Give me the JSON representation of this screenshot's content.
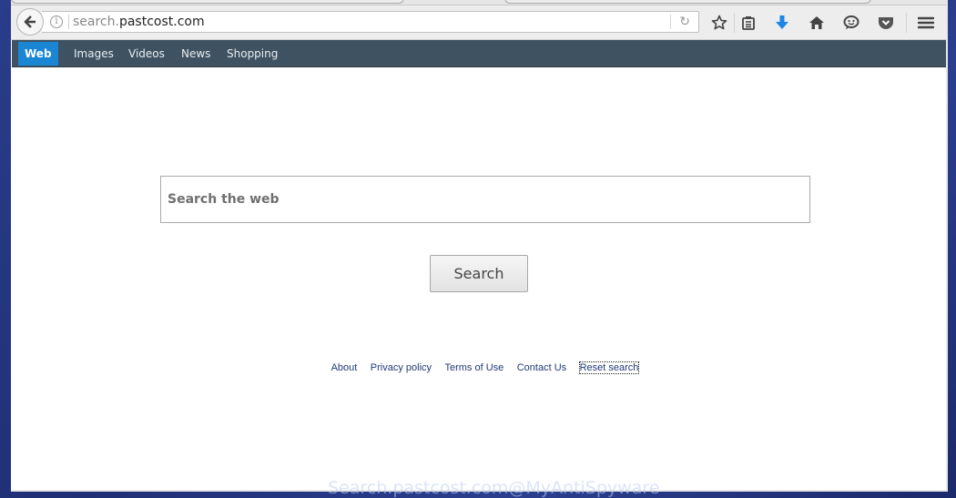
{
  "browser": {
    "url_prefix": "search.",
    "url_domain": "pastcost.com",
    "icons": {
      "back": "back-arrow-icon",
      "info": "info-icon",
      "reload": "reload-icon",
      "bookmark": "star-icon",
      "reading_list": "clipboard-icon",
      "download": "download-arrow-icon",
      "home": "home-icon",
      "chat": "smiley-chat-icon",
      "pocket": "pocket-icon",
      "menu": "hamburger-menu-icon"
    },
    "download_color": "#1a86e8"
  },
  "nav": {
    "items": [
      {
        "label": "Web",
        "active": true
      },
      {
        "label": "Images"
      },
      {
        "label": "Videos"
      },
      {
        "label": "News"
      },
      {
        "label": "Shopping"
      }
    ],
    "bg_color": "#3f5261",
    "active_color": "#1a86d4"
  },
  "search": {
    "placeholder": "Search the web",
    "value": "",
    "button_label": "Search"
  },
  "footer": {
    "links": [
      "About",
      "Privacy policy",
      "Terms of Use",
      "Contact Us",
      "Reset search"
    ]
  },
  "watermark": "Search.pastcost.com@MyAntiSpyware"
}
